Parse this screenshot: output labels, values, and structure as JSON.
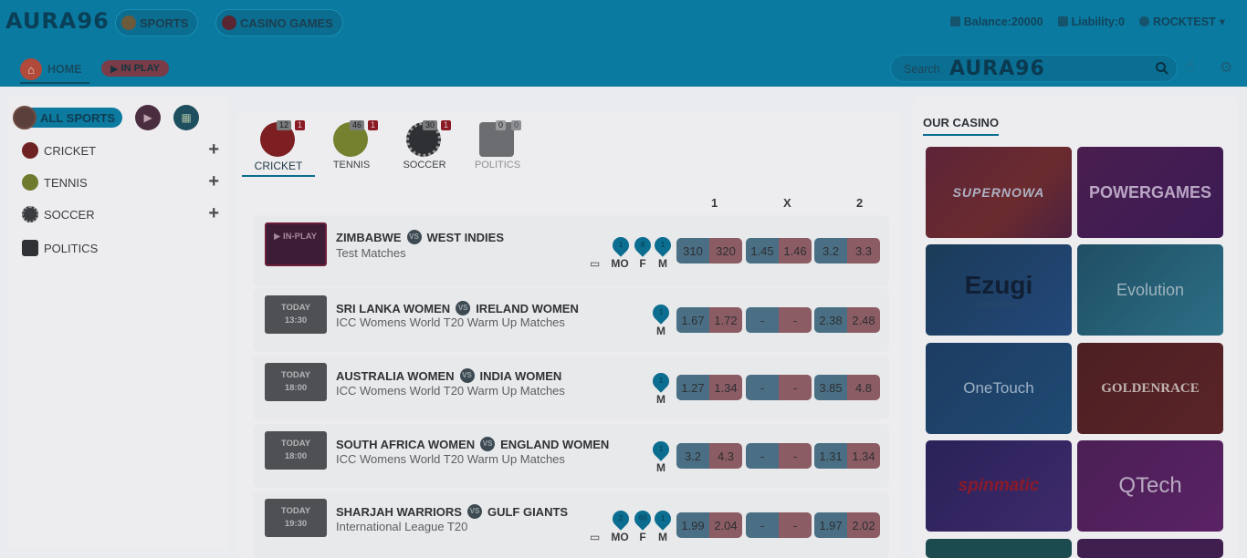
{
  "header": {
    "logo": "AURA96",
    "tabs": [
      {
        "label": "SPORTS"
      },
      {
        "label": "CASINO GAMES"
      }
    ],
    "balance": "Balance:20000",
    "liability": "Liability:0",
    "user": "ROCKTEST",
    "nav": {
      "home": "HOME",
      "inplay": "IN PLAY"
    },
    "search": {
      "placeholder": "Search",
      "watermark": "AURA96"
    }
  },
  "sidebar": {
    "all_sports": "ALL SPORTS",
    "items": [
      {
        "label": "CRICKET"
      },
      {
        "label": "TENNIS"
      },
      {
        "label": "SOCCER"
      },
      {
        "label": "POLITICS"
      }
    ]
  },
  "sport_tabs": [
    {
      "label": "CRICKET",
      "count": "12",
      "live": "1"
    },
    {
      "label": "TENNIS",
      "count": "46",
      "live": "1"
    },
    {
      "label": "SOCCER",
      "count": "30",
      "live": "1"
    },
    {
      "label": "POLITICS",
      "count": "0",
      "live": "0"
    }
  ],
  "odds_headers": [
    "1",
    "X",
    "2"
  ],
  "matches": [
    {
      "status": "IN-PLAY",
      "team_a": "ZIMBABWE",
      "team_b": "WEST INDIES",
      "competition": "Test Matches",
      "markets": [
        {
          "label": "MO",
          "pin": "1"
        },
        {
          "label": "F",
          "pin": "8"
        },
        {
          "label": "M",
          "pin": "1"
        }
      ],
      "odds": [
        [
          "310",
          "320"
        ],
        [
          "1.45",
          "1.46"
        ],
        [
          "3.2",
          "3.3"
        ]
      ]
    },
    {
      "day": "TODAY",
      "time": "13:30",
      "team_a": "SRI LANKA WOMEN",
      "team_b": "IRELAND WOMEN",
      "competition": "ICC Womens World T20 Warm Up Matches",
      "markets": [
        {
          "label": "M",
          "pin": "1"
        }
      ],
      "odds": [
        [
          "1.67",
          "1.72"
        ],
        [
          "-",
          "-"
        ],
        [
          "2.38",
          "2.48"
        ]
      ]
    },
    {
      "day": "TODAY",
      "time": "18:00",
      "team_a": "AUSTRALIA WOMEN",
      "team_b": "INDIA WOMEN",
      "competition": "ICC Womens World T20 Warm Up Matches",
      "markets": [
        {
          "label": "M",
          "pin": "1"
        }
      ],
      "odds": [
        [
          "1.27",
          "1.34"
        ],
        [
          "-",
          "-"
        ],
        [
          "3.85",
          "4.8"
        ]
      ]
    },
    {
      "day": "TODAY",
      "time": "18:00",
      "team_a": "SOUTH AFRICA WOMEN",
      "team_b": "ENGLAND WOMEN",
      "competition": "ICC Womens World T20 Warm Up Matches",
      "markets": [
        {
          "label": "M",
          "pin": "1"
        }
      ],
      "odds": [
        [
          "3.2",
          "4.3"
        ],
        [
          "-",
          "-"
        ],
        [
          "1.31",
          "1.34"
        ]
      ]
    },
    {
      "day": "TODAY",
      "time": "19:30",
      "team_a": "SHARJAH WARRIORS",
      "team_b": "GULF GIANTS",
      "competition": "International League T20",
      "markets": [
        {
          "label": "MO",
          "pin": "2"
        },
        {
          "label": "F",
          "pin": "60"
        },
        {
          "label": "M",
          "pin": "1"
        }
      ],
      "odds": [
        [
          "1.99",
          "2.04"
        ],
        [
          "-",
          "-"
        ],
        [
          "1.97",
          "2.02"
        ]
      ]
    }
  ],
  "casino": {
    "title": "OUR CASINO",
    "providers": [
      {
        "name": "SUPERNOWA"
      },
      {
        "name": "POWERGAMES"
      },
      {
        "name": "Ezugi",
        "tagline": "Smart Move"
      },
      {
        "name": "Evolution"
      },
      {
        "name": "OneTouch"
      },
      {
        "name": "GOLDENRACE"
      },
      {
        "name": "spinmatic"
      },
      {
        "name": "QTech"
      }
    ]
  },
  "icons": [
    "home-icon",
    "play-icon",
    "calendar-icon",
    "search-icon",
    "user-icon",
    "hand-icon",
    "settings-icon",
    "tv-icon"
  ]
}
